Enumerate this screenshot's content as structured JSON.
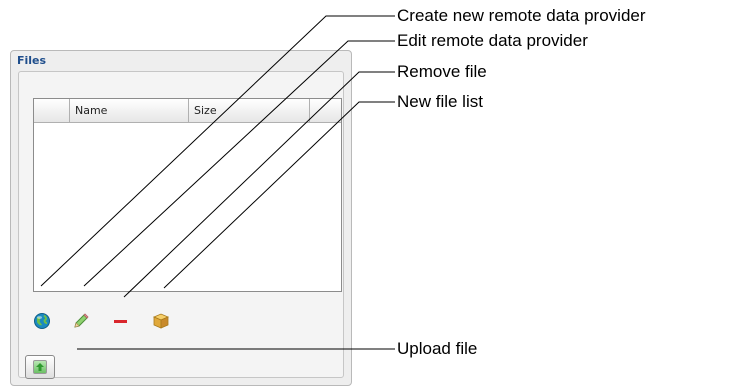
{
  "panel": {
    "title": "Files",
    "table": {
      "columns": [
        "",
        "Name",
        "Size",
        ""
      ]
    },
    "toolbar": {
      "icons": [
        "globe-icon",
        "pencil-icon",
        "minus-icon",
        "box-icon"
      ]
    },
    "upload_button": {
      "icon": "up-arrow-icon"
    }
  },
  "callouts": {
    "create": "Create new remote data provider",
    "edit": "Edit remote data provider",
    "remove": "Remove file",
    "new_list": "New file list",
    "upload": "Upload file"
  },
  "colors": {
    "title": "#1f4e8c",
    "globe": "#1a8ac0",
    "pencil": "#5aa04a",
    "remove": "#d9262c",
    "box": "#e0a83a",
    "upload_arrow": "#3aa33a"
  }
}
